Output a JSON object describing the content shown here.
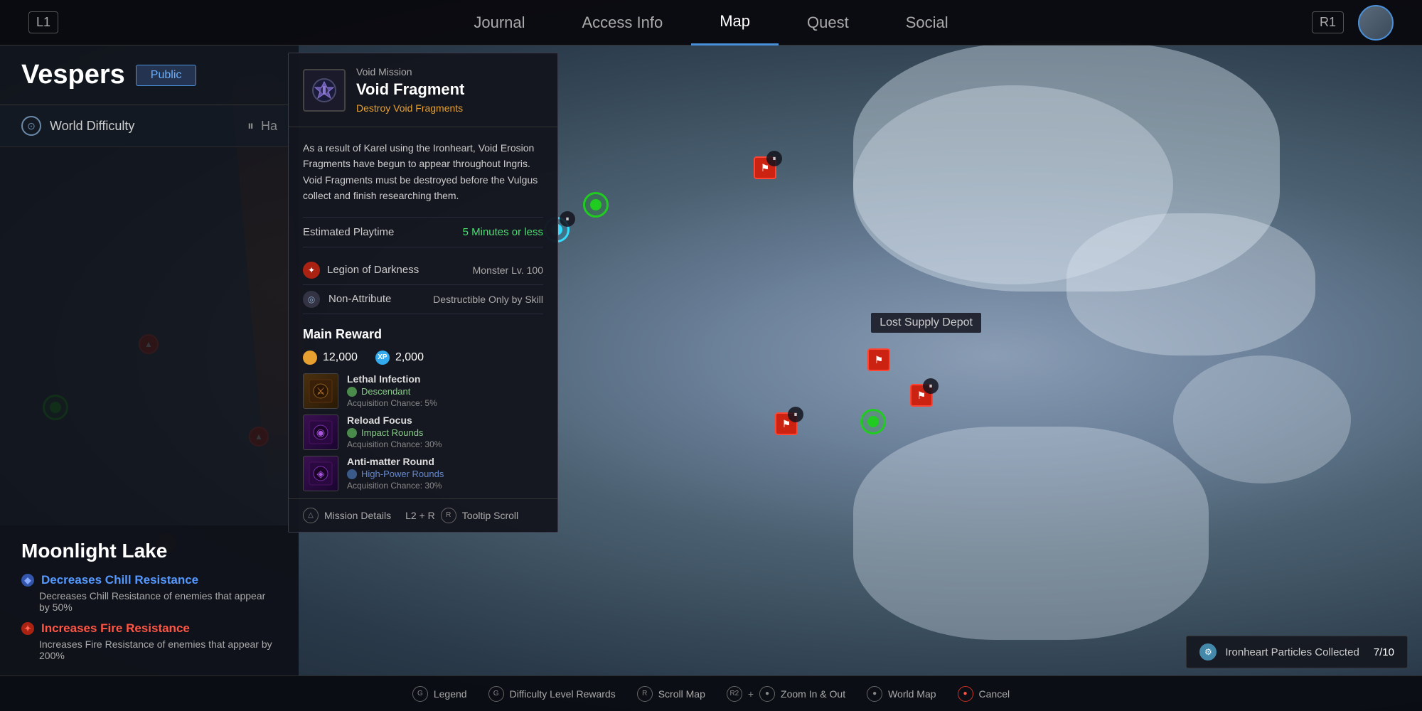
{
  "nav": {
    "left_btn": "L1",
    "right_btn": "R1",
    "items": [
      {
        "label": "Journal",
        "active": false
      },
      {
        "label": "Access Info",
        "active": false
      },
      {
        "label": "Map",
        "active": true
      },
      {
        "label": "Quest",
        "active": false
      },
      {
        "label": "Social",
        "active": false
      }
    ]
  },
  "panel": {
    "title": "Vespers",
    "public_btn": "Public",
    "world_difficulty": "World Difficulty",
    "difficulty_suffix": "Ha"
  },
  "location": {
    "name": "Moonlight Lake",
    "effects": [
      {
        "type": "blue",
        "title": "Decreases Chill Resistance",
        "desc": "Decreases Chill Resistance of enemies that appear by 50%"
      },
      {
        "type": "red",
        "title": "Increases Fire Resistance",
        "desc": "Increases Fire Resistance of enemies that appear by 200%"
      }
    ]
  },
  "mission": {
    "type": "Void Mission",
    "name": "Void Fragment",
    "subtitle": "Destroy Void Fragments",
    "desc": "As a result of Karel using the Ironheart, Void Erosion Fragments have begun to appear throughout Ingris. Void Fragments must be destroyed before the Vulgus collect and finish researching them.",
    "playtime_label": "Estimated Playtime",
    "playtime_value": "5 Minutes or less",
    "enemy": {
      "name": "Legion of Darkness",
      "level": "Monster Lv. 100"
    },
    "attribute": {
      "name": "Non-Attribute",
      "value": "Destructible Only by Skill"
    },
    "reward": {
      "title": "Main Reward",
      "gold": "12,000",
      "xp": "2,000",
      "items": [
        {
          "name": "Lethal Infection",
          "type": "Descendant",
          "type_color": "green",
          "chance": "Acquisition Chance: 5%",
          "color": "brown"
        },
        {
          "name": "Reload Focus",
          "type": "Impact Rounds",
          "type_color": "green",
          "chance": "Acquisition Chance: 30%",
          "color": "purple"
        },
        {
          "name": "Anti-matter Round",
          "type": "High-Power Rounds",
          "type_color": "blue",
          "chance": "Acquisition Chance: 30%",
          "color": "purple"
        }
      ]
    },
    "footer": {
      "mission_details": "Mission Details",
      "tooltip_scroll": "Tooltip Scroll",
      "tooltip_combo": "L2 + R"
    }
  },
  "map_labels": {
    "lost_supply_depot": "Lost Supply Depot"
  },
  "ironheart": {
    "label": "Ironheart Particles Collected",
    "count": "7/10"
  },
  "bottom_bar": {
    "items": [
      {
        "icon": "●",
        "label": "Legend"
      },
      {
        "icon": "●",
        "label": "Difficulty Level Rewards"
      },
      {
        "icon": "R",
        "label": "Scroll Map"
      },
      {
        "icon": "R2+●",
        "label": "Zoom In & Out"
      },
      {
        "icon": "●",
        "label": "World Map"
      },
      {
        "icon": "●",
        "label": "Cancel",
        "red": true
      }
    ]
  }
}
